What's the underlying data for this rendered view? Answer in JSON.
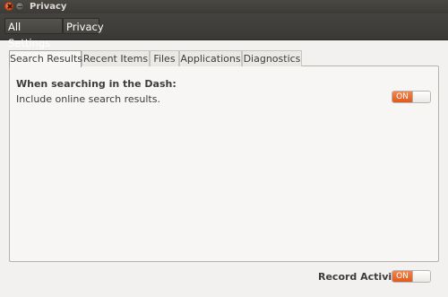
{
  "window": {
    "title": "Privacy"
  },
  "breadcrumb": {
    "all_settings": "All Settings",
    "current": "Privacy"
  },
  "tabs": [
    {
      "label": "Search Results",
      "active": true
    },
    {
      "label": "Recent Items",
      "active": false
    },
    {
      "label": "Files",
      "active": false
    },
    {
      "label": "Applications",
      "active": false
    },
    {
      "label": "Diagnostics",
      "active": false
    }
  ],
  "search_results": {
    "heading": "When searching in the Dash:",
    "online_label": "Include online search results.",
    "online_switch": {
      "state_label": "ON",
      "on": true
    }
  },
  "footer": {
    "record_label": "Record Activity",
    "record_switch": {
      "state_label": "ON",
      "on": true
    }
  },
  "colors": {
    "accent": "#e05a1c",
    "titlebar": "#3d3b37",
    "window_bg": "#f2f1f0"
  }
}
